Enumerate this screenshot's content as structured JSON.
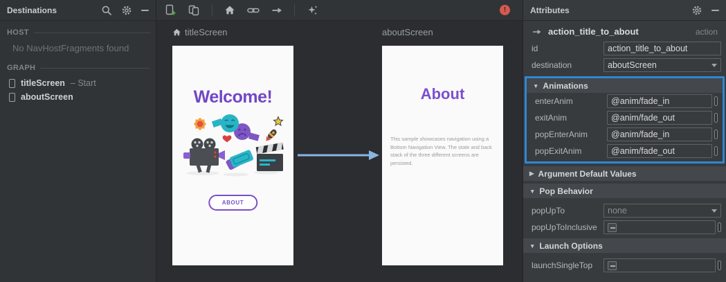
{
  "colors": {
    "highlight_blue": "#2e87d5",
    "action_arrow_blue": "#8ab4e4",
    "brand_purple": "#7147c5",
    "error_red": "#d5594f"
  },
  "destinations": {
    "title": "Destinations",
    "host_label": "HOST",
    "host_empty": "No NavHostFragments found",
    "graph_label": "GRAPH",
    "items": [
      {
        "label": "titleScreen",
        "suffix": "– Start"
      },
      {
        "label": "aboutScreen",
        "suffix": ""
      }
    ]
  },
  "canvas": {
    "title_screen": {
      "name": "titleScreen",
      "heading": "Welcome!",
      "button_label": "ABOUT"
    },
    "about_screen": {
      "name": "aboutScreen",
      "heading": "About",
      "body": "This sample showcases navigation using a Bottom Navigation View. The state and back stack of the three different screens are persisted."
    }
  },
  "attributes": {
    "title": "Attributes",
    "action_name": "action_title_to_about",
    "action_type": "action",
    "id_label": "id",
    "id_value": "action_title_to_about",
    "destination_label": "destination",
    "destination_value": "aboutScreen",
    "sections": {
      "animations": {
        "title": "Animations",
        "rows": [
          {
            "label": "enterAnim",
            "value": "@anim/fade_in"
          },
          {
            "label": "exitAnim",
            "value": "@anim/fade_out"
          },
          {
            "label": "popEnterAnim",
            "value": "@anim/fade_in"
          },
          {
            "label": "popExitAnim",
            "value": "@anim/fade_out"
          }
        ]
      },
      "argument_defaults": {
        "title": "Argument Default Values"
      },
      "pop_behavior": {
        "title": "Pop Behavior",
        "popupto_label": "popUpTo",
        "popupto_value": "none",
        "popuptoinclusive_label": "popUpToInclusive"
      },
      "launch_options": {
        "title": "Launch Options",
        "launchsingletop_label": "launchSingleTop"
      }
    }
  }
}
